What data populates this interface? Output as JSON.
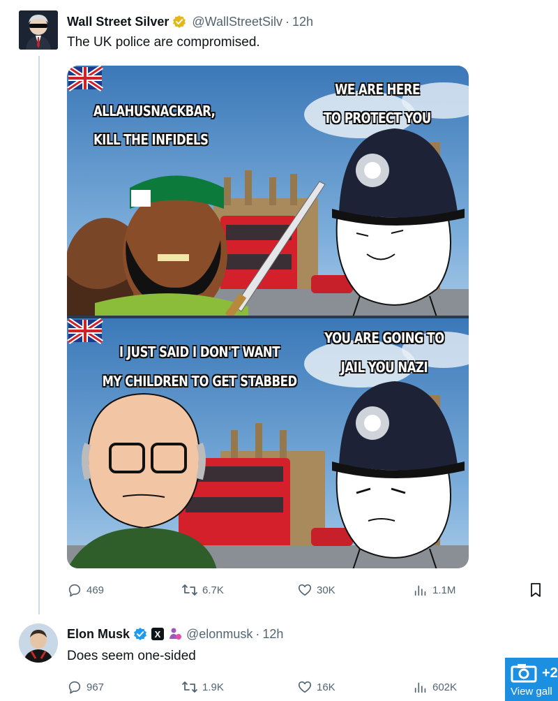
{
  "tweet1": {
    "display_name": "Wall Street Silver",
    "handle": "@WallStreetSilv",
    "separator": "·",
    "time": "12h",
    "text": "The UK police are compromised.",
    "meme": {
      "top_left_caption_line1": "ALLAHUSNACKBAR,",
      "top_left_caption_line2": "KILL THE INFIDELS",
      "top_right_caption_line1": "WE ARE HERE",
      "top_right_caption_line2": "TO PROTECT YOU",
      "bottom_left_caption_line1": "I JUST SAID I DON'T WANT",
      "bottom_left_caption_line2": "MY CHILDREN TO GET STABBED",
      "bottom_right_caption_line1": "YOU ARE GOING TO",
      "bottom_right_caption_line2": "JAIL YOU NAZI"
    },
    "actions": {
      "replies": "469",
      "reposts": "6.7K",
      "likes": "30K",
      "views": "1.1M"
    }
  },
  "tweet2": {
    "display_name": "Elon Musk",
    "handle": "@elonmusk",
    "separator": "·",
    "time": "12h",
    "text": "Does seem one-sided",
    "actions": {
      "replies": "967",
      "reposts": "1.9K",
      "likes": "16K",
      "views": "602K"
    }
  },
  "gallery": {
    "count": "+2",
    "label": "View gall"
  },
  "colors": {
    "text": "#0f1419",
    "muted": "#536471",
    "verified_gold": "#e2b719",
    "verified_blue": "#1d9bf0",
    "gallery_blue": "#1d8fe0"
  },
  "icons": [
    "reply-icon",
    "repost-icon",
    "like-icon",
    "views-icon",
    "bookmark-icon",
    "camera-icon",
    "verified-badge-icon",
    "x-affiliate-icon"
  ]
}
